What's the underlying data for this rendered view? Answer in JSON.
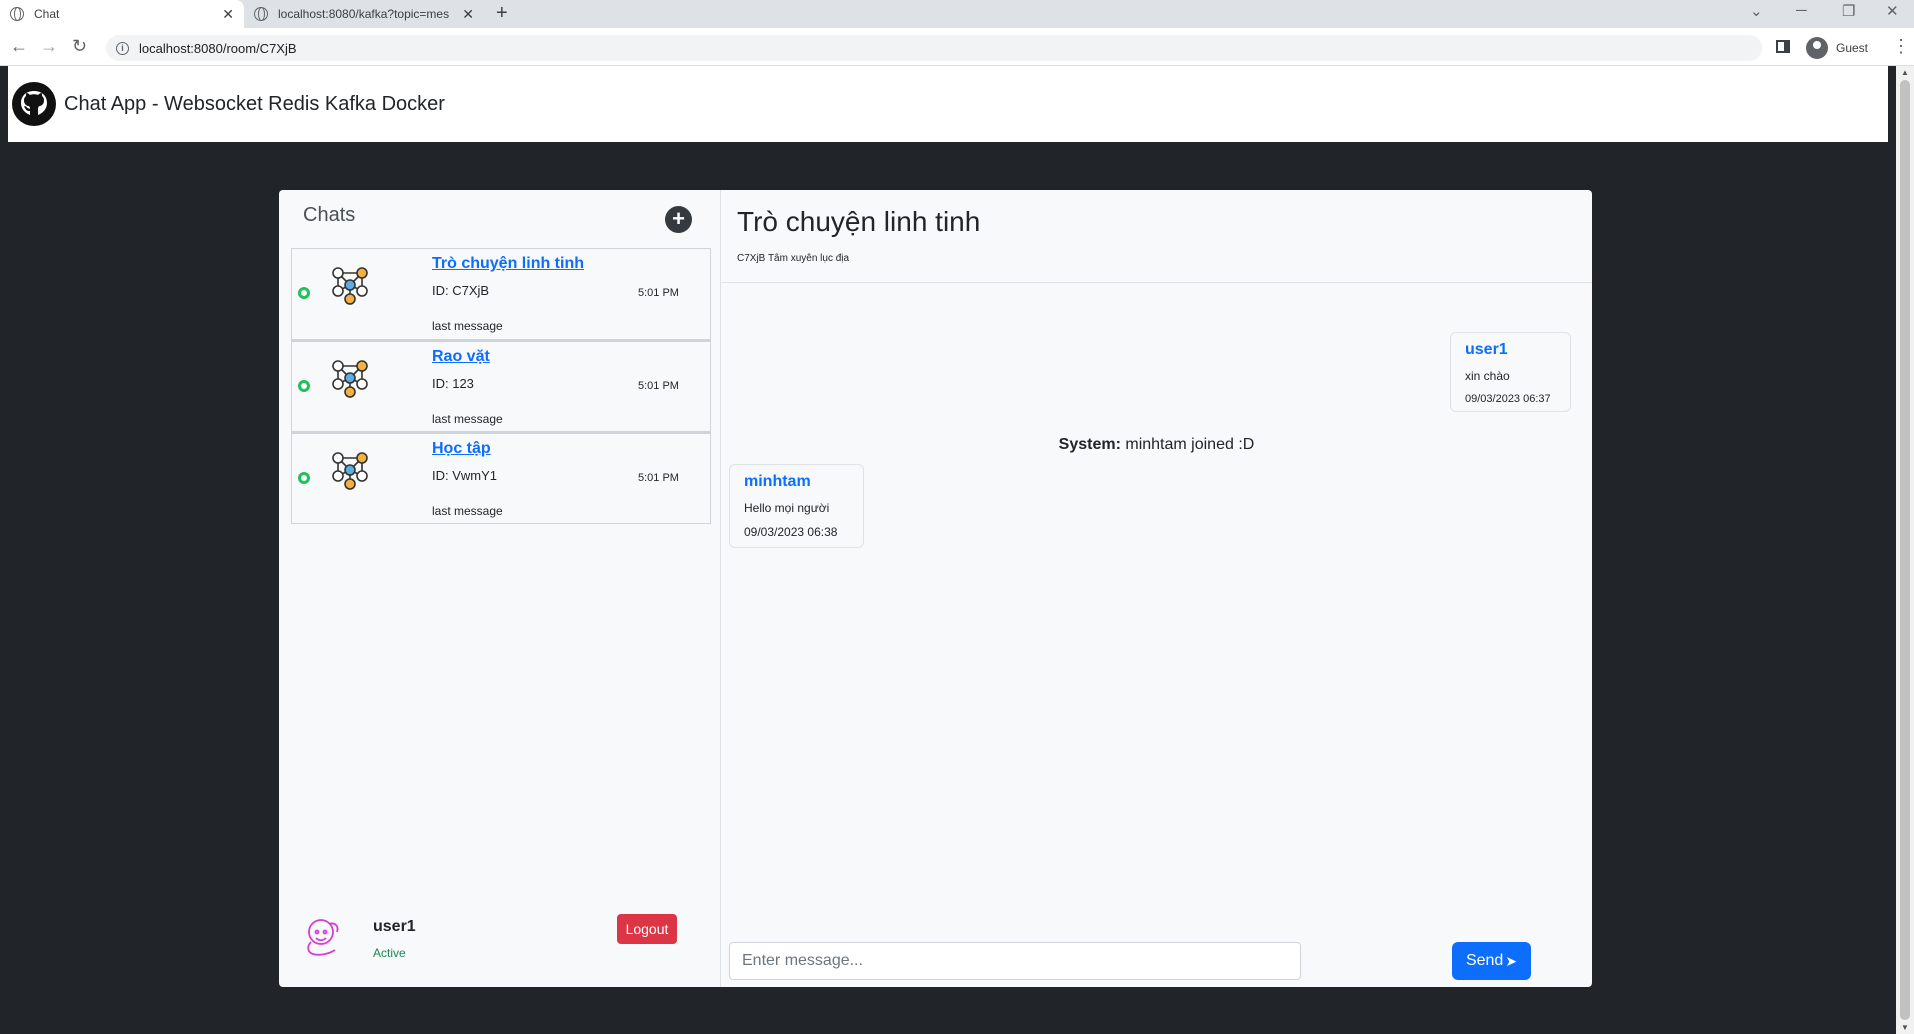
{
  "browser": {
    "tabs": [
      {
        "title": "Chat"
      },
      {
        "title": "localhost:8080/kafka?topic=mes"
      }
    ],
    "address": "localhost:8080/room/C7XjB",
    "profile": "Guest"
  },
  "header": {
    "title": "Chat App - Websocket Redis Kafka Docker"
  },
  "sidebar": {
    "title": "Chats",
    "rooms": [
      {
        "name": "Trò chuyện linh tinh",
        "id": "ID: C7XjB",
        "time": "5:01 PM",
        "last": "last message"
      },
      {
        "name": "Rao vặt",
        "id": "ID: 123",
        "time": "5:01 PM",
        "last": "last message"
      },
      {
        "name": "Học tập",
        "id": "ID: VwmY1",
        "time": "5:01 PM",
        "last": "last message"
      }
    ],
    "user": {
      "name": "user1",
      "status": "Active",
      "logout_label": "Logout"
    }
  },
  "chat": {
    "title": "Trò chuyện linh tinh",
    "subtitle": "C7XjB Tâm xuyên lục địa",
    "messages": [
      {
        "sender": "user1",
        "text": "xin chào",
        "time": "09/03/2023 06:37"
      },
      {
        "sender": "minhtam",
        "text": "Hello mọi người",
        "time": "09/03/2023 06:38"
      }
    ],
    "system": {
      "label": "System:",
      "text": "minhtam joined :D"
    },
    "input_placeholder": "Enter message...",
    "send_label": "Send"
  },
  "colors": {
    "primary": "#0d6efd",
    "danger": "#dc3545",
    "success": "#198754",
    "online": "#20c15b",
    "page_bg": "#212529"
  }
}
